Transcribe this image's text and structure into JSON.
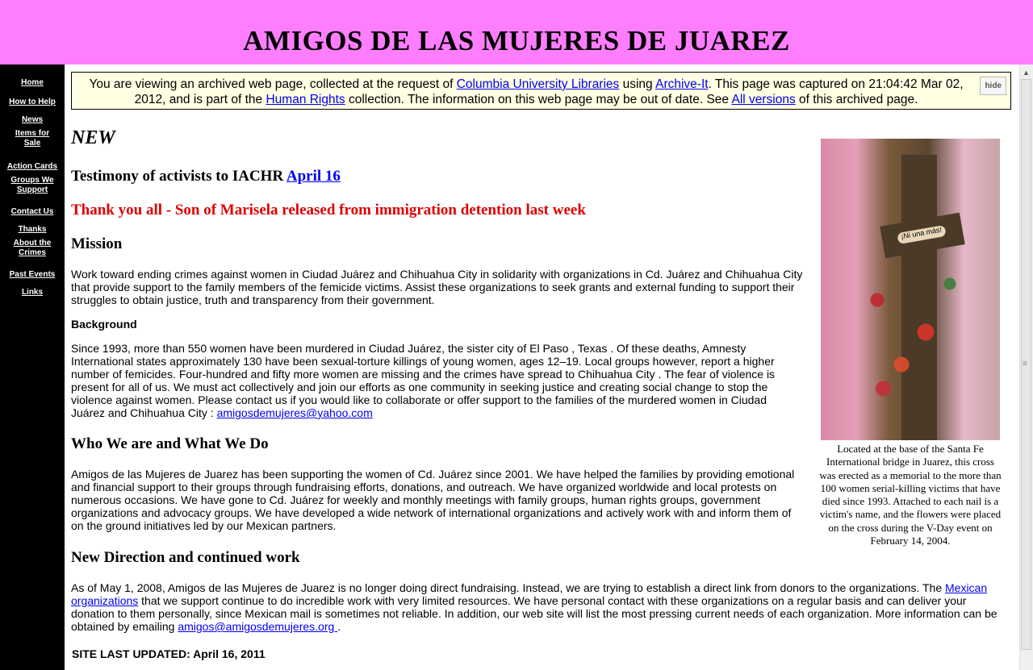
{
  "site_title": "AMIGOS DE LAS MUJERES DE JUAREZ",
  "nav": [
    {
      "line1": "Home",
      "line2": ""
    },
    {
      "line1": "How to Help",
      "line2": ""
    },
    {
      "line1": "News",
      "line2": ""
    },
    {
      "line1": "Items for",
      "line2": "Sale"
    },
    {
      "line1": "Action Cards",
      "line2": ""
    },
    {
      "line1": "Groups We",
      "line2": "Support"
    },
    {
      "line1": "Contact Us",
      "line2": ""
    },
    {
      "line1": "Thanks",
      "line2": ""
    },
    {
      "line1": "About the",
      "line2": "Crimes"
    },
    {
      "line1": "Past Events",
      "line2": ""
    },
    {
      "line1": "Links",
      "line2": ""
    }
  ],
  "banner": {
    "t1": "You are viewing an archived web page, collected at the request of ",
    "l1": "Columbia University Libraries",
    "t2": " using ",
    "l2": "Archive-It",
    "t3": ". This page was captured on 21:04:42 Mar 02, 2012, and is part of the ",
    "l3": "Human Rights",
    "t4": " collection. The information on this web page may be out of date. See ",
    "l4": "All versions",
    "t5": " of this archived page.",
    "hide": "hide"
  },
  "new_heading": "NEW",
  "testimony": {
    "text": "Testimony of activists to IACHR ",
    "link": "April 16"
  },
  "thanks_line": "Thank you all - Son of Marisela released from immigration detention last week",
  "mission": {
    "heading": "Mission",
    "text": "Work toward ending crimes against women in Ciudad Juárez and Chihuahua City in solidarity with organizations in Cd. Juárez and Chihuahua City that provide support to the family members of the femicide victims. Assist these organizations to seek grants and external funding to support their struggles to obtain justice, truth and transparency from their government."
  },
  "background": {
    "heading": "Background",
    "text": "Since 1993, more than 550 women have been murdered in Ciudad Juárez, the sister city of El Paso , Texas . Of these deaths, Amnesty International states approximately 130 have been sexual-torture killings of young women, ages 12–19. Local groups however, report a higher number of femicides. Four-hundred and fifty more women are missing and the crimes have spread to Chihuahua City . The fear of violence is present for all of us. We must act collectively and join our efforts as one community in seeking justice and creating social change to stop the violence against women. Please contact us if you would like to collaborate or offer support to the families of the murdered women in Ciudad Juárez and Chihuahua City : ",
    "email": "amigosdemujeres@yahoo.com"
  },
  "who": {
    "heading": "Who We are and What We Do",
    "text": "Amigos de las Mujeres de Juarez has been supporting the women of Cd. Juárez since 2001. We have helped the families by providing emotional and financial support to their groups through fundraising efforts, donations, and outreach. We have organized worldwide and local protests on numerous occasions. We have gone to Cd. Juárez for weekly and monthly meetings with family groups, human rights groups, government organizations and advocacy groups. We have developed a wide network of international organizations and actively work with and inform them of on the ground initiatives led by our Mexican partners."
  },
  "direction": {
    "heading": "New Direction and continued work",
    "t1": "As of May 1, 2008, Amigos de las Mujeres de Juarez is no longer doing direct fundraising. Instead, we are trying to establish a direct link from donors to the organizations. The ",
    "link": "Mexican organizations",
    "t2": " that we support continue to do incredible work with very limited resources. We have personal contact with these organizations on a regular basis and can deliver your donation to them personally, since Mexican mail is sometimes not reliable. In addition, our web site will list the most pressing current needs of each organization. More information can be obtained by emailing ",
    "email": "amigos@amigosdemujeres.org ",
    "t3": "."
  },
  "updated": "SITE LAST UPDATED: April 16, 2011",
  "photo": {
    "sign": "¡Ni una más!"
  },
  "caption": "Located at the base of the Santa Fe International bridge in Juarez, this cross was erected as a memorial to the more than 100 women serial-killing victims that have died since 1993.  Attached to each nail is a victim's name, and the flowers were placed on the cross during the V-Day event on February 14, 2004.",
  "colors": {
    "header_bg": "#ff7dff",
    "sidebar_bg": "#000000",
    "banner_bg": "#ffffe3",
    "link": "#0000ee",
    "alert": "#dd0000"
  }
}
